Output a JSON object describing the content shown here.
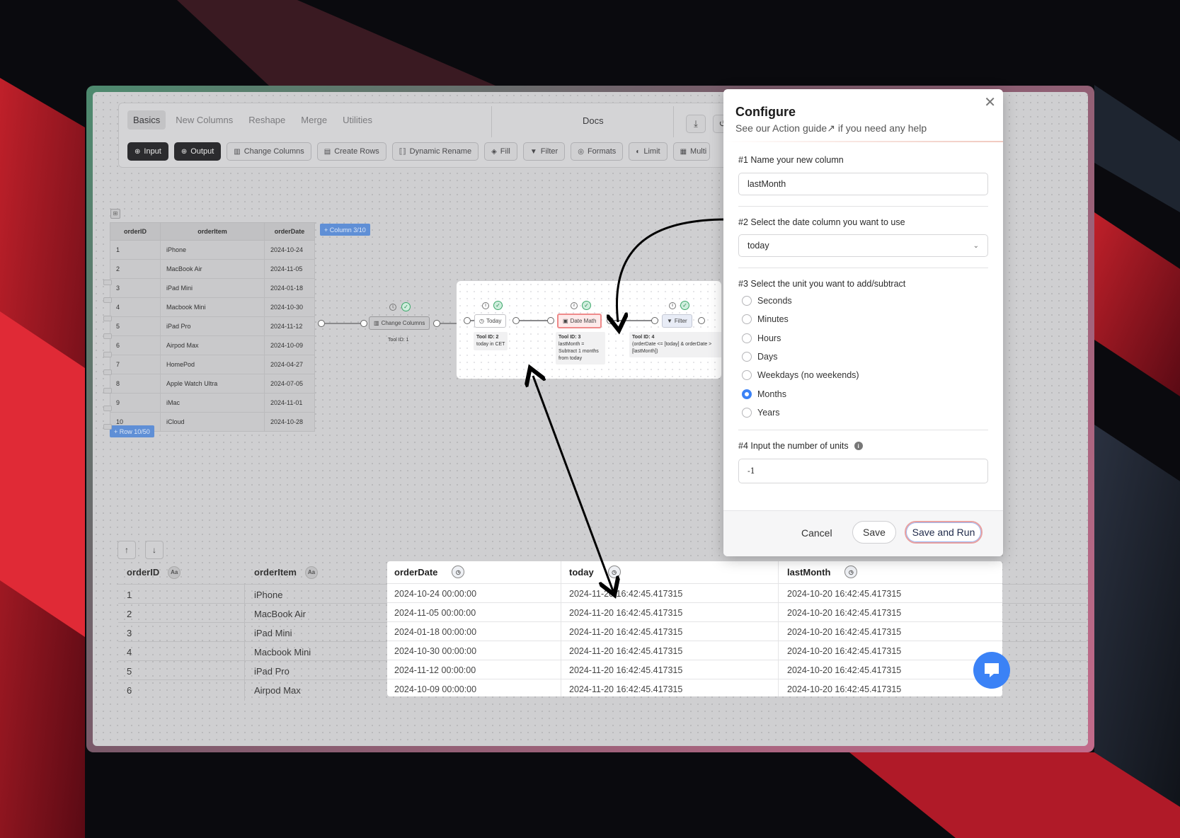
{
  "toolbar": {
    "tabs": [
      "Basics",
      "New Columns",
      "Reshape",
      "Merge",
      "Utilities"
    ],
    "docs_label": "Docs",
    "tools": [
      "Input",
      "Output",
      "Change Columns",
      "Create Rows",
      "Dynamic Rename",
      "Fill",
      "Filter",
      "Formats",
      "Limit",
      "Multi"
    ]
  },
  "input_table": {
    "columns": [
      "orderID",
      "orderItem",
      "orderDate"
    ],
    "rows": [
      [
        "1",
        "iPhone",
        "2024-10-24"
      ],
      [
        "2",
        "MacBook Air",
        "2024-11-05"
      ],
      [
        "3",
        "iPad Mini",
        "2024-01-18"
      ],
      [
        "4",
        "Macbook Mini",
        "2024-10-30"
      ],
      [
        "5",
        "iPad Pro",
        "2024-11-12"
      ],
      [
        "6",
        "Airpod Max",
        "2024-10-09"
      ],
      [
        "7",
        "HomePod",
        "2024-04-27"
      ],
      [
        "8",
        "Apple Watch Ultra",
        "2024-07-05"
      ],
      [
        "9",
        "iMac",
        "2024-11-01"
      ],
      [
        "10",
        "iCloud",
        "2024-10-28"
      ]
    ],
    "add_column": "+ Column 3/10",
    "add_row": "+ Row 10/50"
  },
  "flow": {
    "change_columns": {
      "label": "Change Columns",
      "caption": "Tool ID: 1"
    },
    "today": {
      "label": "Today",
      "caption_id": "Tool ID: 2",
      "caption_text": "today in CET"
    },
    "date_math": {
      "label": "Date Math",
      "caption_id": "Tool ID: 3",
      "caption_l1": "lastMonth =",
      "caption_l2": "Subtract 1 months",
      "caption_l3": "from today"
    },
    "filter": {
      "label": "Filter",
      "caption_id": "Tool ID: 4",
      "caption_l1": "(orderDate <= [today] & orderDate >",
      "caption_l2": "[lastMonth])"
    }
  },
  "output_table": {
    "columns": [
      "orderID",
      "orderItem",
      "orderDate",
      "today",
      "lastMonth"
    ],
    "type_text": "Aa",
    "rows": [
      [
        "1",
        "iPhone",
        "2024-10-24 00:00:00",
        "2024-11-20 16:42:45.417315",
        "2024-10-20 16:42:45.417315"
      ],
      [
        "2",
        "MacBook Air",
        "2024-11-05 00:00:00",
        "2024-11-20 16:42:45.417315",
        "2024-10-20 16:42:45.417315"
      ],
      [
        "3",
        "iPad Mini",
        "2024-01-18 00:00:00",
        "2024-11-20 16:42:45.417315",
        "2024-10-20 16:42:45.417315"
      ],
      [
        "4",
        "Macbook Mini",
        "2024-10-30 00:00:00",
        "2024-11-20 16:42:45.417315",
        "2024-10-20 16:42:45.417315"
      ],
      [
        "5",
        "iPad Pro",
        "2024-11-12 00:00:00",
        "2024-11-20 16:42:45.417315",
        "2024-10-20 16:42:45.417315"
      ],
      [
        "6",
        "Airpod Max",
        "2024-10-09 00:00:00",
        "2024-11-20 16:42:45.417315",
        "2024-10-20 16:42:45.417315"
      ]
    ]
  },
  "configure": {
    "title": "Configure",
    "subtitle_prefix": "See our ",
    "subtitle_link": "Action guide↗",
    "subtitle_suffix": " if you need any help",
    "s1_label": "#1 Name your new column",
    "s1_value": "lastMonth",
    "s2_label": "#2 Select the date column you want to use",
    "s2_value": "today",
    "s3_label": "#3 Select the unit you want to add/subtract",
    "units": [
      "Seconds",
      "Minutes",
      "Hours",
      "Days",
      "Weekdays (no weekends)",
      "Months",
      "Years"
    ],
    "selected_unit": "Months",
    "s4_label": "#4 Input the number of units",
    "s4_value": "-1",
    "cancel": "Cancel",
    "save": "Save",
    "save_run": "Save and Run"
  }
}
